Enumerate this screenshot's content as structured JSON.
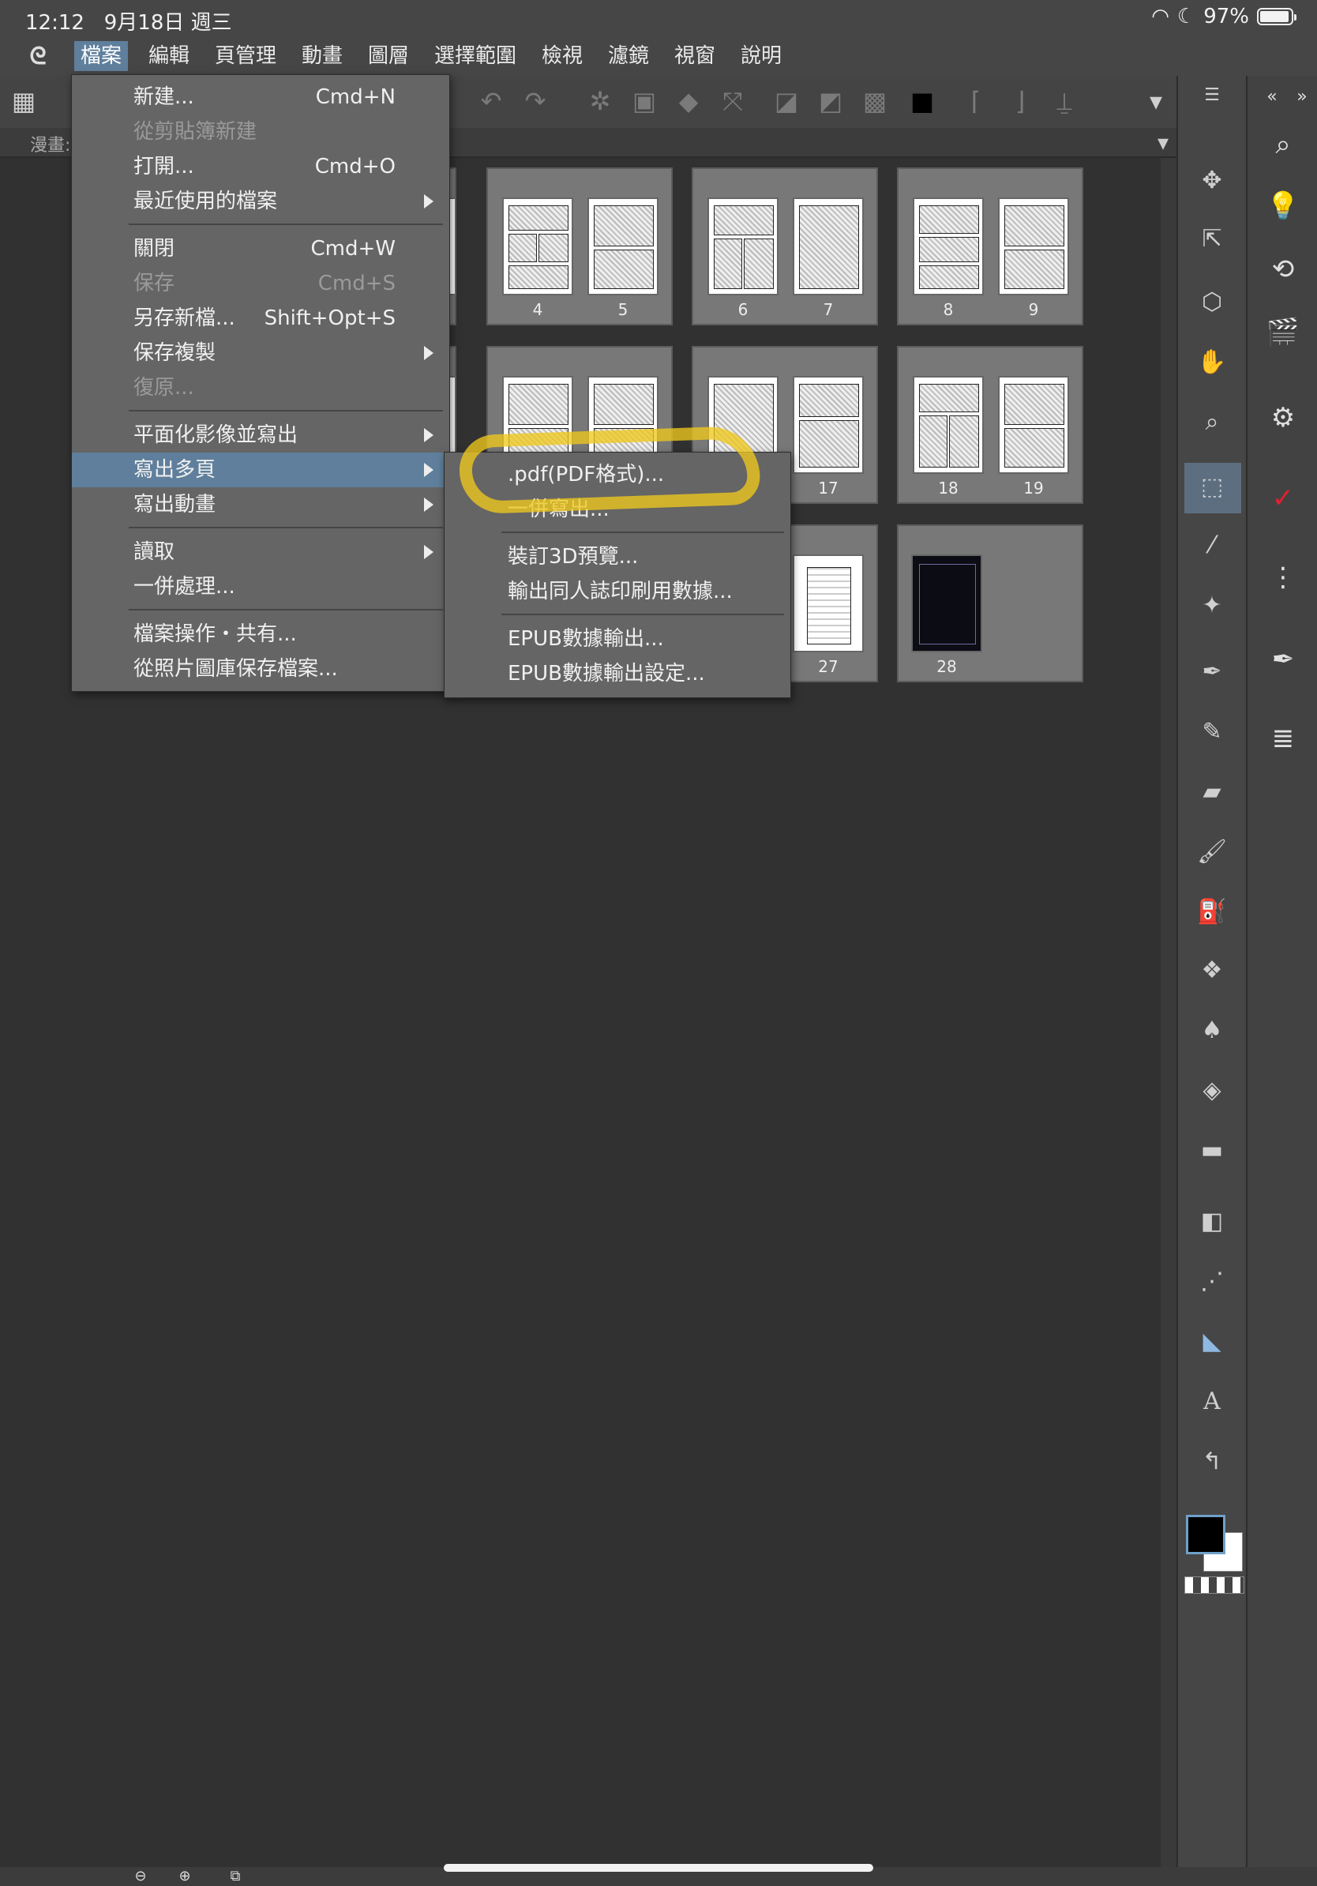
{
  "status_bar": {
    "time": "12:12",
    "date": "9月18日 週三",
    "battery": "97%"
  },
  "menu_bar": {
    "items": [
      "檔案",
      "編輯",
      "頁管理",
      "動畫",
      "圖層",
      "選擇範圍",
      "檢視",
      "濾鏡",
      "視窗",
      "說明"
    ]
  },
  "tab": {
    "label": "漫畫:"
  },
  "file_menu": {
    "new": {
      "label": "新建...",
      "shortcut": "Cmd+N"
    },
    "new_from_clipboard": {
      "label": "從剪貼簿新建"
    },
    "open": {
      "label": "打開...",
      "shortcut": "Cmd+O"
    },
    "recent": {
      "label": "最近使用的檔案"
    },
    "close": {
      "label": "關閉",
      "shortcut": "Cmd+W"
    },
    "save": {
      "label": "保存",
      "shortcut": "Cmd+S"
    },
    "save_as": {
      "label": "另存新檔...",
      "shortcut": "Shift+Opt+S"
    },
    "save_copy": {
      "label": "保存複製"
    },
    "revert": {
      "label": "復原..."
    },
    "export_flat": {
      "label": "平面化影像並寫出"
    },
    "export_multi": {
      "label": "寫出多頁"
    },
    "export_anim": {
      "label": "寫出動畫"
    },
    "import": {
      "label": "讀取"
    },
    "batch": {
      "label": "一併處理..."
    },
    "file_share": {
      "label": "檔案操作・共有..."
    },
    "save_from_photos": {
      "label": "從照片圖庫保存檔案..."
    }
  },
  "submenu": {
    "pdf": ".pdf(PDF格式)...",
    "batch_export": "一併寫出...",
    "binding_3d": "裝訂3D預覽...",
    "doujin_print": "輸出同人誌印刷用數據...",
    "epub_export": "EPUB數據輸出...",
    "epub_settings": "EPUB數據輸出設定..."
  },
  "pages": [
    "4",
    "5",
    "6",
    "7",
    "8",
    "9",
    "17",
    "18",
    "19",
    "27",
    "28"
  ],
  "colors": {
    "menu_highlight": "#5f7f9c",
    "annotation": "#f0c81e"
  }
}
